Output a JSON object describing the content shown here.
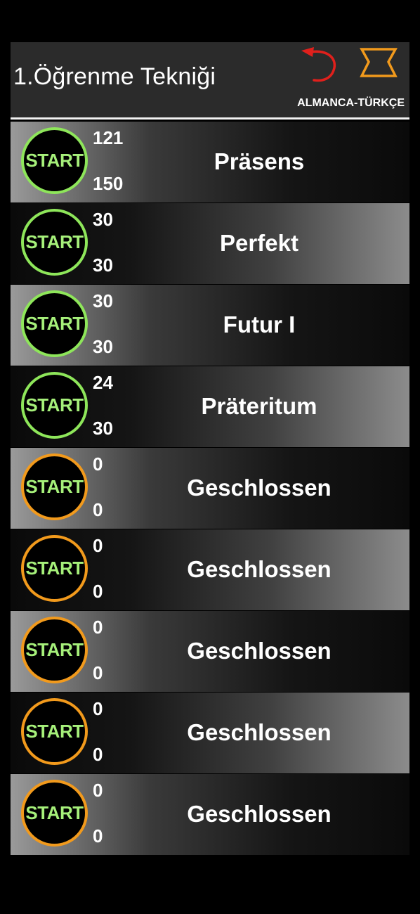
{
  "header": {
    "title": "1.Öğrenme Tekniği",
    "subtitle": "ALMANCA-TÜRKÇE",
    "back_icon": "back-arrow-icon",
    "hourglass_icon": "hourglass-icon",
    "colors": {
      "back_icon": "#e0201c",
      "hourglass_icon": "#f29a1c"
    }
  },
  "start_label": "START",
  "colors": {
    "unlocked_ring": "#8ee65a",
    "locked_ring": "#f29a1c",
    "start_text": "#a6f07a"
  },
  "rows": [
    {
      "title": "Präsens",
      "top": "121",
      "bottom": "150",
      "status": "unlocked"
    },
    {
      "title": "Perfekt",
      "top": "30",
      "bottom": "30",
      "status": "unlocked"
    },
    {
      "title": "Futur I",
      "top": "30",
      "bottom": "30",
      "status": "unlocked"
    },
    {
      "title": "Präteritum",
      "top": "24",
      "bottom": "30",
      "status": "unlocked"
    },
    {
      "title": "Geschlossen",
      "top": "0",
      "bottom": "0",
      "status": "locked"
    },
    {
      "title": "Geschlossen",
      "top": "0",
      "bottom": "0",
      "status": "locked"
    },
    {
      "title": "Geschlossen",
      "top": "0",
      "bottom": "0",
      "status": "locked"
    },
    {
      "title": "Geschlossen",
      "top": "0",
      "bottom": "0",
      "status": "locked"
    },
    {
      "title": "Geschlossen",
      "top": "0",
      "bottom": "0",
      "status": "locked"
    }
  ]
}
